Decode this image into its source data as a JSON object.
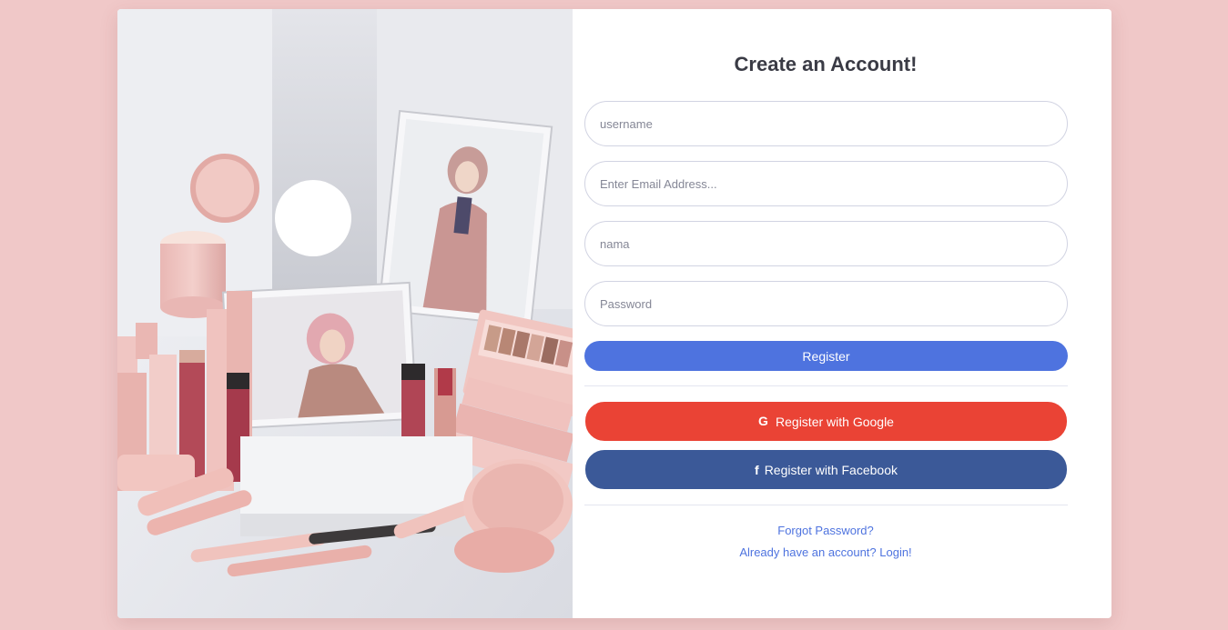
{
  "page": {
    "title": "Create an Account!"
  },
  "form": {
    "username_placeholder": "username",
    "email_placeholder": "Enter Email Address...",
    "nama_placeholder": "nama",
    "password_placeholder": "Password",
    "register_label": "Register",
    "google_label": "Register with Google",
    "facebook_label": "Register with Facebook"
  },
  "links": {
    "forgot_password": "Forgot Password?",
    "login": "Already have an account? Login!"
  },
  "icons": {
    "google": "google-icon",
    "facebook": "facebook-icon"
  },
  "colors": {
    "background": "#f0c8c8",
    "primary": "#4e73df",
    "google": "#ea4335",
    "facebook": "#3b5998"
  }
}
